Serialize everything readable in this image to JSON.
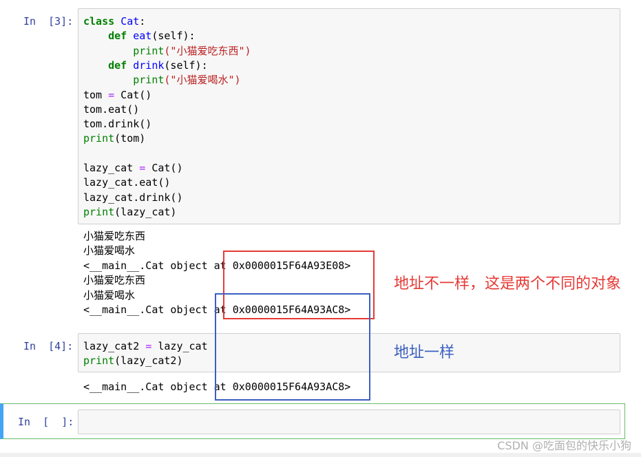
{
  "cells": [
    {
      "prompt": "In  [3]:",
      "code": [
        [
          {
            "t": "class",
            "c": "kw"
          },
          {
            "t": " "
          },
          {
            "t": "Cat",
            "c": "nm"
          },
          {
            "t": ":"
          }
        ],
        [
          {
            "t": "    "
          },
          {
            "t": "def",
            "c": "kw"
          },
          {
            "t": " "
          },
          {
            "t": "eat",
            "c": "fn"
          },
          {
            "t": "(self):"
          }
        ],
        [
          {
            "t": "        "
          },
          {
            "t": "print",
            "c": "bi"
          },
          {
            "t": "(\"小猫爱吃东西\")",
            "c": "st"
          }
        ],
        [
          {
            "t": "    "
          },
          {
            "t": "def",
            "c": "kw"
          },
          {
            "t": " "
          },
          {
            "t": "drink",
            "c": "fn"
          },
          {
            "t": "(self):"
          }
        ],
        [
          {
            "t": "        "
          },
          {
            "t": "print",
            "c": "bi"
          },
          {
            "t": "(\"小猫爱喝水\")",
            "c": "st"
          }
        ],
        [
          {
            "t": "tom "
          },
          {
            "t": "=",
            "c": "op"
          },
          {
            "t": " Cat()"
          }
        ],
        [
          {
            "t": "tom.eat()"
          }
        ],
        [
          {
            "t": "tom.drink()"
          }
        ],
        [
          {
            "t": "print",
            "c": "bi"
          },
          {
            "t": "(tom)"
          }
        ],
        [
          {
            "t": ""
          }
        ],
        [
          {
            "t": "lazy_cat "
          },
          {
            "t": "=",
            "c": "op"
          },
          {
            "t": " Cat()"
          }
        ],
        [
          {
            "t": "lazy_cat.eat()"
          }
        ],
        [
          {
            "t": "lazy_cat.drink()"
          }
        ],
        [
          {
            "t": "print",
            "c": "bi"
          },
          {
            "t": "(lazy_cat)"
          }
        ]
      ],
      "output": [
        "小猫爱吃东西",
        "小猫爱喝水",
        "<__main__.Cat object at 0x0000015F64A93E08>",
        "小猫爱吃东西",
        "小猫爱喝水",
        "<__main__.Cat object at 0x0000015F64A93AC8>"
      ]
    },
    {
      "prompt": "In  [4]:",
      "code": [
        [
          {
            "t": "lazy_cat2 "
          },
          {
            "t": "=",
            "c": "op"
          },
          {
            "t": " lazy_cat"
          }
        ],
        [
          {
            "t": "print",
            "c": "bi"
          },
          {
            "t": "(lazy_cat2)"
          }
        ]
      ],
      "output": [
        "<__main__.Cat object at 0x0000015F64A93AC8>"
      ]
    },
    {
      "prompt": "In  [  ]:",
      "code": [],
      "output": []
    }
  ],
  "annotations": {
    "red_text": "地址不一样，这是两个不同的对象",
    "red_color": "#e53935",
    "blue_text": "地址一样",
    "blue_color": "#3b5fc0"
  },
  "watermark": "CSDN @吃面包的快乐小狗"
}
